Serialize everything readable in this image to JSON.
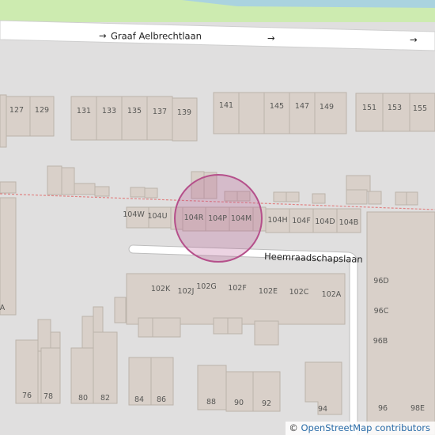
{
  "map": {
    "streets": {
      "graaf": "Graaf Aelbrechtlaan",
      "heemraad": "Heemraadschapslaan"
    },
    "house_numbers": {
      "n127": "127",
      "n129": "129",
      "n131": "131",
      "n133": "133",
      "n135": "135",
      "n137": "137",
      "n139": "139",
      "n141": "141",
      "n145": "145",
      "n147": "147",
      "n149": "149",
      "n151": "151",
      "n153": "153",
      "n155": "155",
      "n104W": "104W",
      "n104U": "104U",
      "n104R": "104R",
      "n104P": "104P",
      "n104M": "104M",
      "n104H": "104H",
      "n104F": "104F",
      "n104D": "104D",
      "n104B": "104B",
      "n102K": "102K",
      "n102J": "102J",
      "n102G": "102G",
      "n102F": "102F",
      "n102E": "102E",
      "n102C": "102C",
      "n102A": "102A",
      "n96D": "96D",
      "n96C": "96C",
      "n96B": "96B",
      "n96": "96",
      "n98E": "98E",
      "n76": "76",
      "n78": "78",
      "n80": "80",
      "n82": "82",
      "n84": "84",
      "n86": "86",
      "n88": "88",
      "n90": "90",
      "n92": "92",
      "n94": "94",
      "nA": "A"
    },
    "colors": {
      "background": "#e0dfdf",
      "building": "#d9d0c9",
      "road": "#ffffff",
      "water": "#aad3df",
      "park": "#cdebb0",
      "marker": "#b5508b",
      "boundary": "#e07a7a"
    }
  },
  "attribution": {
    "symbol": "©",
    "text": "OpenStreetMap contributors"
  }
}
